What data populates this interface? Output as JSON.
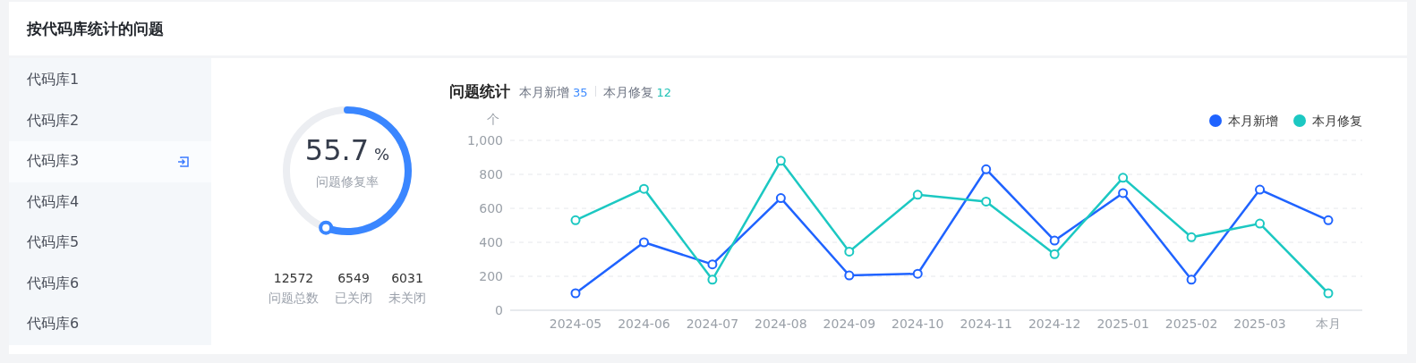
{
  "panel": {
    "title": "按代码库统计的问题"
  },
  "repos": [
    {
      "label": "代码库1",
      "selected": false
    },
    {
      "label": "代码库2",
      "selected": false
    },
    {
      "label": "代码库3",
      "selected": true
    },
    {
      "label": "代码库4",
      "selected": false
    },
    {
      "label": "代码库5",
      "selected": false
    },
    {
      "label": "代码库6",
      "selected": false
    },
    {
      "label": "代码库6",
      "selected": false
    }
  ],
  "gauge": {
    "value": "55.7",
    "unit": "%",
    "label": "问题修复率"
  },
  "stats": [
    {
      "value": "12572",
      "label": "问题总数"
    },
    {
      "value": "6549",
      "label": "已关闭"
    },
    {
      "value": "6031",
      "label": "未关闭"
    }
  ],
  "chart": {
    "title": "问题统计",
    "summary": [
      {
        "label": "本月新增",
        "value": "35",
        "color": "#3d8bff"
      },
      {
        "label": "本月修复",
        "value": "12",
        "color": "#1fc2b5"
      }
    ],
    "chart_data": {
      "type": "line",
      "grid": true,
      "legend": true,
      "ylabel": "个",
      "categories": [
        "2024-05",
        "2024-06",
        "2024-07",
        "2024-08",
        "2024-09",
        "2024-10",
        "2024-11",
        "2024-12",
        "2025-01",
        "2025-02",
        "2025-03",
        "本月"
      ],
      "ylim": [
        0,
        1000
      ],
      "yticks": [
        {
          "value": 0,
          "label": "0"
        },
        {
          "value": 200,
          "label": "200"
        },
        {
          "value": 400,
          "label": "400"
        },
        {
          "value": 600,
          "label": "600"
        },
        {
          "value": 800,
          "label": "800"
        },
        {
          "value": 1000,
          "label": "1,000"
        }
      ],
      "series": [
        {
          "name": "本月新增",
          "color": "#1f63ff",
          "marker": "circle",
          "values": [
            100,
            400,
            270,
            660,
            205,
            215,
            830,
            410,
            690,
            180,
            710,
            530
          ]
        },
        {
          "name": "本月修复",
          "color": "#1cc8c2",
          "marker": "circle",
          "values": [
            530,
            715,
            180,
            880,
            345,
            680,
            640,
            330,
            780,
            430,
            510,
            100
          ]
        }
      ]
    }
  }
}
